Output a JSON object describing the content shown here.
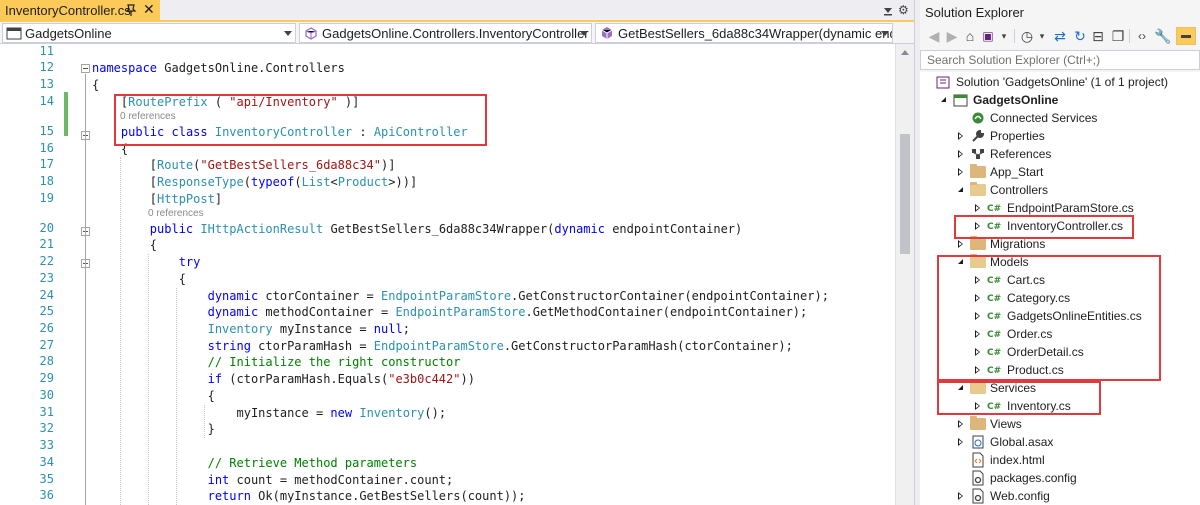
{
  "editor": {
    "tab_title": "InventoryController.cs",
    "nav": {
      "project": "GadgetsOnline",
      "type": "GadgetsOnline.Controllers.InventoryController",
      "member": "GetBestSellers_6da88c34Wrapper(dynamic endpo"
    },
    "code_lines": [
      {
        "n": "11",
        "html": ""
      },
      {
        "n": "12",
        "html": "<span class='kw'>namespace</span> GadgetsOnline.Controllers"
      },
      {
        "n": "13",
        "html": "{"
      },
      {
        "n": "14",
        "html": "    [<span class='ty'>RoutePrefix</span> ( <span class='st'>\"api/Inventory\"</span> )]"
      },
      {
        "n": "15",
        "html": "    <span class='kw'>public</span> <span class='kw'>class</span> <span class='ty'>InventoryController</span> : <span class='ty'>ApiController</span>"
      },
      {
        "n": "16",
        "html": "    {"
      },
      {
        "n": "17",
        "html": "        [<span class='ty'>Route</span>(<span class='st'>\"GetBestSellers_6da88c34\"</span>)]"
      },
      {
        "n": "18",
        "html": "        [<span class='ty'>ResponseType</span>(<span class='kw'>typeof</span>(<span class='ty'>List</span>&lt;<span class='ty'>Product</span>&gt;))]"
      },
      {
        "n": "19",
        "html": "        [<span class='ty'>HttpPost</span>]"
      },
      {
        "n": "20",
        "html": "        <span class='kw'>public</span> <span class='ty'>IHttpActionResult</span> GetBestSellers_6da88c34Wrapper(<span class='kw'>dynamic</span> endpointContainer)"
      },
      {
        "n": "21",
        "html": "        {"
      },
      {
        "n": "22",
        "html": "            <span class='kw'>try</span>"
      },
      {
        "n": "23",
        "html": "            {"
      },
      {
        "n": "24",
        "html": "                <span class='kw'>dynamic</span> ctorContainer = <span class='ty'>EndpointParamStore</span>.GetConstructorContainer(endpointContainer);"
      },
      {
        "n": "25",
        "html": "                <span class='kw'>dynamic</span> methodContainer = <span class='ty'>EndpointParamStore</span>.GetMethodContainer(endpointContainer);"
      },
      {
        "n": "26",
        "html": "                <span class='ty'>Inventory</span> myInstance = <span class='kw'>null</span>;"
      },
      {
        "n": "27",
        "html": "                <span class='kw'>string</span> ctorParamHash = <span class='ty'>EndpointParamStore</span>.GetConstructorParamHash(ctorContainer);"
      },
      {
        "n": "28",
        "html": "                <span class='cm'>// Initialize the right constructor</span>"
      },
      {
        "n": "29",
        "html": "                <span class='kw'>if</span> (ctorParamHash.Equals(<span class='st'>\"e3b0c442\"</span>))"
      },
      {
        "n": "30",
        "html": "                {"
      },
      {
        "n": "31",
        "html": "                    myInstance = <span class='kw'>new</span> <span class='ty'>Inventory</span>();"
      },
      {
        "n": "32",
        "html": "                }"
      },
      {
        "n": "33",
        "html": ""
      },
      {
        "n": "34",
        "html": "                <span class='cm'>// Retrieve Method parameters</span>"
      },
      {
        "n": "35",
        "html": "                <span class='kw'>int</span> count = methodContainer.count;"
      },
      {
        "n": "36",
        "html": "                <span class='kw'>return</span> Ok(myInstance.GetBestSellers(count));"
      }
    ],
    "refs_label_1": "0 references",
    "refs_label_2": "0 references"
  },
  "solution_explorer": {
    "title": "Solution Explorer",
    "search_placeholder": "Search Solution Explorer (Ctrl+;)",
    "items": [
      {
        "label": "Solution 'GadgetsOnline' (1 of 1 project)",
        "icon": "solution-icon",
        "expander": "none"
      },
      {
        "label": "GadgetsOnline",
        "icon": "csharp-project-icon",
        "expander": "open",
        "bold": true
      },
      {
        "label": "Connected Services",
        "icon": "connected-services-icon",
        "expander": "none"
      },
      {
        "label": "Properties",
        "icon": "wrench-icon",
        "expander": "closed"
      },
      {
        "label": "References",
        "icon": "references-icon",
        "expander": "closed"
      },
      {
        "label": "App_Start",
        "icon": "folder-icon",
        "expander": "closed"
      },
      {
        "label": "Controllers",
        "icon": "folder-open-icon",
        "expander": "open"
      },
      {
        "label": "EndpointParamStore.cs",
        "icon": "cs-file-icon",
        "expander": "closed"
      },
      {
        "label": "InventoryController.cs",
        "icon": "cs-file-icon",
        "expander": "closed"
      },
      {
        "label": "Migrations",
        "icon": "folder-icon",
        "expander": "closed"
      },
      {
        "label": "Models",
        "icon": "folder-open-icon",
        "expander": "open"
      },
      {
        "label": "Cart.cs",
        "icon": "cs-file-icon",
        "expander": "closed"
      },
      {
        "label": "Category.cs",
        "icon": "cs-file-icon",
        "expander": "closed"
      },
      {
        "label": "GadgetsOnlineEntities.cs",
        "icon": "cs-file-icon",
        "expander": "closed"
      },
      {
        "label": "Order.cs",
        "icon": "cs-file-icon",
        "expander": "closed"
      },
      {
        "label": "OrderDetail.cs",
        "icon": "cs-file-icon",
        "expander": "closed"
      },
      {
        "label": "Product.cs",
        "icon": "cs-file-icon",
        "expander": "closed"
      },
      {
        "label": "Services",
        "icon": "folder-open-icon",
        "expander": "open"
      },
      {
        "label": "Inventory.cs",
        "icon": "cs-file-icon",
        "expander": "closed"
      },
      {
        "label": "Views",
        "icon": "folder-icon",
        "expander": "closed"
      },
      {
        "label": "Global.asax",
        "icon": "global-asax-icon",
        "expander": "closed"
      },
      {
        "label": "index.html",
        "icon": "html-file-icon",
        "expander": "none"
      },
      {
        "label": "packages.config",
        "icon": "config-file-icon",
        "expander": "none"
      },
      {
        "label": "Web.config",
        "icon": "config-file-icon",
        "expander": "closed"
      }
    ]
  },
  "colors": {
    "active_tab": "#fcca58",
    "highlight_box": "#e4393c",
    "keyword": "#0000ff",
    "type": "#2b91af",
    "string": "#a31515",
    "comment": "#008000"
  }
}
